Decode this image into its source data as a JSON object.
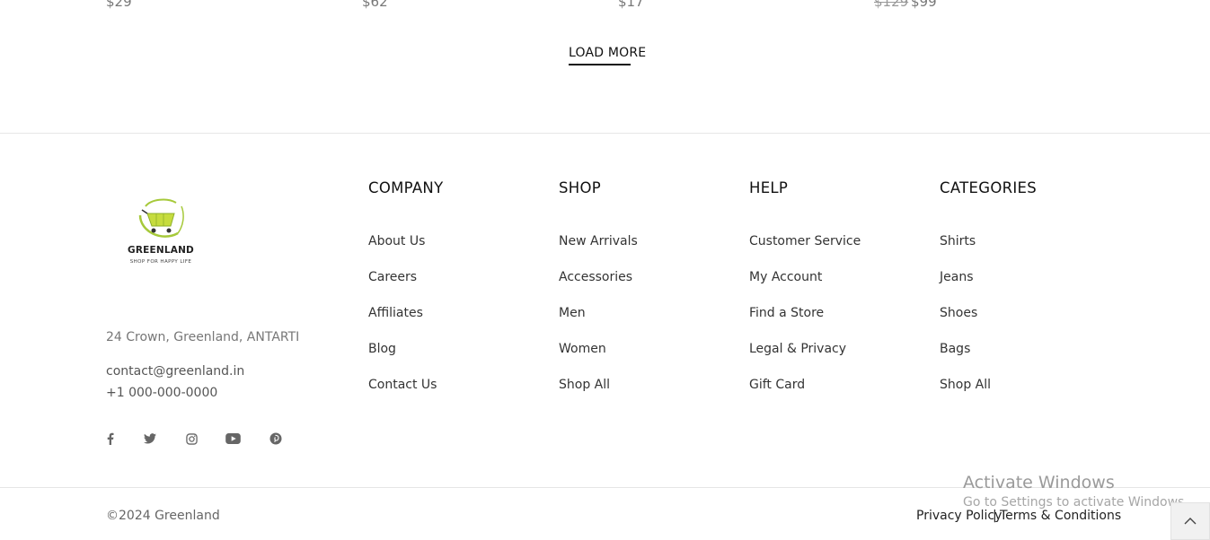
{
  "products": {
    "prices": [
      {
        "current": "$29"
      },
      {
        "current": "$62"
      },
      {
        "current": "$17"
      },
      {
        "old": "$129",
        "current": "$99"
      }
    ]
  },
  "load_more": {
    "label": "LOAD MORE"
  },
  "brand": {
    "name": "GREENLAND",
    "tagline": "SHOP FOR HAPPY LIFE",
    "accent_color": "#a6c93a"
  },
  "contact": {
    "address": "24 Crown, Greenland, ANTARTI",
    "email": "contact@greenland.in",
    "phone": "+1 000-000-0000"
  },
  "social": [
    "facebook-icon",
    "twitter-icon",
    "instagram-icon",
    "youtube-icon",
    "pinterest-icon"
  ],
  "columns": [
    {
      "title": "COMPANY",
      "links": [
        "About Us",
        "Careers",
        "Affiliates",
        "Blog",
        "Contact Us"
      ]
    },
    {
      "title": "SHOP",
      "links": [
        "New Arrivals",
        "Accessories",
        "Men",
        "Women",
        "Shop All"
      ]
    },
    {
      "title": "HELP",
      "links": [
        "Customer Service",
        "My Account",
        "Find a Store",
        "Legal & Privacy",
        "Gift Card"
      ]
    },
    {
      "title": "CATEGORIES",
      "links": [
        "Shirts",
        "Jeans",
        "Shoes",
        "Bags",
        "Shop All"
      ]
    }
  ],
  "footer": {
    "copyright": "©2024 Greenland",
    "privacy": "Privacy Policy",
    "separator": "|",
    "terms": "Terms & Conditions"
  },
  "watermark": {
    "title": "Activate Windows",
    "subtitle": "Go to Settings to activate Windows."
  }
}
